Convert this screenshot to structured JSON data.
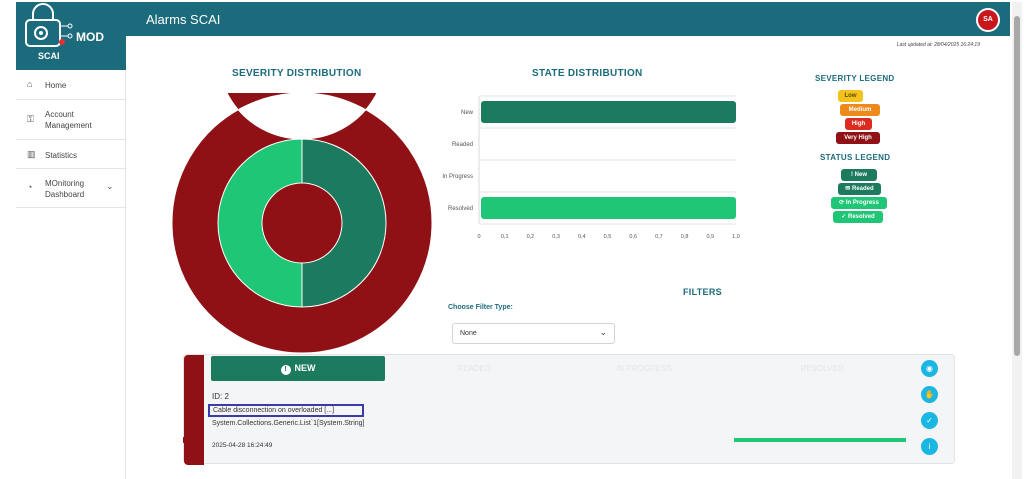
{
  "app": {
    "logo_text": "MOD",
    "logo_sub": "SCAI",
    "header_title": "Alarms SCAI",
    "avatar_initials": "SA",
    "brand_color": "#1c6b7c"
  },
  "sidebar": {
    "items": [
      {
        "label": "Home",
        "icon": "home-icon"
      },
      {
        "label": "Account Management",
        "icon": "user-lock-icon"
      },
      {
        "label": "Statistics",
        "icon": "bar-chart-icon"
      },
      {
        "label": "MOnitoring Dashboard",
        "icon": "monitor-icon"
      }
    ]
  },
  "main": {
    "last_updated": "Last updated at: 28/04/2025 16:24:19",
    "severity_title": "SEVERITY DISTRIBUTION",
    "state_title": "STATE DISTRIBUTION",
    "severity_legend_title": "SEVERITY LEGEND",
    "status_legend_title": "STATUS LEGEND",
    "filters_title": "FILTERS",
    "filter_label": "Choose Filter Type:",
    "filter_value": "None"
  },
  "severity_legend": [
    {
      "label": "Low",
      "color": "#f3c21b",
      "text": "#5a4400"
    },
    {
      "label": "Medium",
      "color": "#ee8a1c",
      "text": "#ffffff"
    },
    {
      "label": "High",
      "color": "#dc2b1f",
      "text": "#ffffff"
    },
    {
      "label": "Very High",
      "color": "#8f1116",
      "text": "#ffffff"
    }
  ],
  "status_legend": [
    {
      "label": "New",
      "icon": "exclamation-icon",
      "color": "#1c7a5e"
    },
    {
      "label": "Readed",
      "icon": "envelope-open-icon",
      "color": "#1c7a5e"
    },
    {
      "label": "In Progress",
      "icon": "sync-icon",
      "color": "#1ec675"
    },
    {
      "label": "Resolved",
      "icon": "check-circle-icon",
      "color": "#1ec675"
    }
  ],
  "chart_data": [
    {
      "type": "pie",
      "title": "SEVERITY DISTRIBUTION",
      "rings": [
        {
          "name": "severity",
          "slices": [
            {
              "label": "Very High",
              "value": 1,
              "color": "#8f1116"
            }
          ]
        },
        {
          "name": "state",
          "slices": [
            {
              "label": "New",
              "value": 1,
              "color": "#1c7a5e"
            },
            {
              "label": "Resolved",
              "value": 1,
              "color": "#1ec675"
            }
          ]
        }
      ]
    },
    {
      "type": "bar",
      "orientation": "horizontal",
      "title": "STATE DISTRIBUTION",
      "categories": [
        "New",
        "Readed",
        "In Progress",
        "Resolved"
      ],
      "values": [
        1.0,
        0,
        0,
        1.0
      ],
      "colors": [
        "#1c7a5e",
        "#1c7a5e",
        "#1ec675",
        "#1ec675"
      ],
      "xlim": [
        0,
        1.0
      ],
      "xticks": [
        "0",
        "0,1",
        "0,2",
        "0,3",
        "0,4",
        "0,5",
        "0,6",
        "0,7",
        "0,8",
        "0,9",
        "1,0"
      ],
      "grid": true
    }
  ],
  "alarm_card": {
    "tab_new": "NEW",
    "tabs_ghost": [
      "READED",
      "IN PROGRESS",
      "RESOLVED"
    ],
    "id_text": "ID: 2",
    "description": "Cable disconnection on overloaded [...]",
    "detail": "System.Collections.Generic.List`1[System.String]",
    "timestamp": "2025-04-28 16:24:49",
    "actions": [
      "eye-icon",
      "hand-icon",
      "check-icon",
      "info-icon"
    ]
  }
}
